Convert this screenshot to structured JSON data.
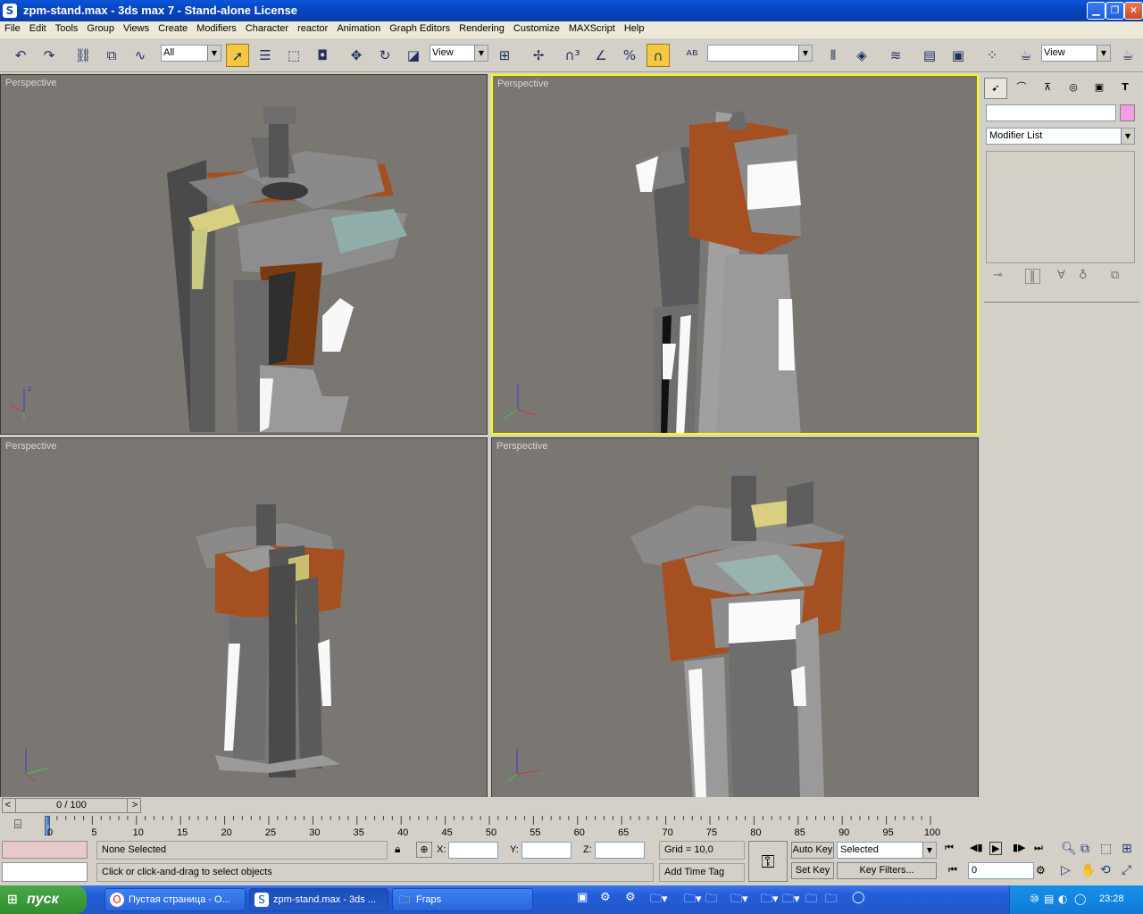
{
  "window": {
    "title": "zpm-stand.max - 3ds max 7   - Stand-alone License",
    "buttons": {
      "minimize": "▁",
      "maximize": "❐",
      "close": "✕"
    }
  },
  "menu": [
    "File",
    "Edit",
    "Tools",
    "Group",
    "Views",
    "Create",
    "Modifiers",
    "Character",
    "reactor",
    "Animation",
    "Graph Editors",
    "Rendering",
    "Customize",
    "MAXScript",
    "Help"
  ],
  "toolbar": {
    "selection_filter": "All",
    "ref_coord": "View",
    "named_selection": "",
    "render_view": "View"
  },
  "viewports": [
    {
      "label": "Perspective",
      "active": false
    },
    {
      "label": "Perspective",
      "active": true
    },
    {
      "label": "Perspective",
      "active": false
    },
    {
      "label": "Perspective",
      "active": false
    }
  ],
  "axes": {
    "x": "x",
    "y": "y",
    "z": "z"
  },
  "command_panel": {
    "name_field": "",
    "modifier_list": "Modifier List",
    "color_swatch": "#f0a0e0"
  },
  "timeline": {
    "frame_counter": "0 / 100",
    "prev_arrow": "<",
    "next_arrow": ">",
    "ticks": [
      "0",
      "5",
      "10",
      "15",
      "20",
      "25",
      "30",
      "35",
      "40",
      "45",
      "50",
      "55",
      "60",
      "65",
      "70",
      "75",
      "80",
      "85",
      "90",
      "95",
      "100"
    ]
  },
  "status": {
    "selection": "None Selected",
    "prompt": "Click or click-and-drag to select objects",
    "x_label": "X:",
    "y_label": "Y:",
    "z_label": "Z:",
    "x_value": "",
    "y_value": "",
    "z_value": "",
    "grid": "Grid = 10,0",
    "add_time_tag": "Add Time Tag",
    "auto_key": "Auto Key",
    "set_key": "Set Key",
    "key_mode": "Selected",
    "key_filters": "Key Filters...",
    "current_frame": "0"
  },
  "taskbar": {
    "start": "пуск",
    "tasks": [
      {
        "label": "Пустая страница - О...",
        "icon": "opera-icon"
      },
      {
        "label": "zpm-stand.max - 3ds ...",
        "icon": "3dsmax-icon"
      },
      {
        "label": "Fraps",
        "icon": "folder-icon"
      }
    ],
    "language": "EN",
    "clock": "23:28"
  }
}
